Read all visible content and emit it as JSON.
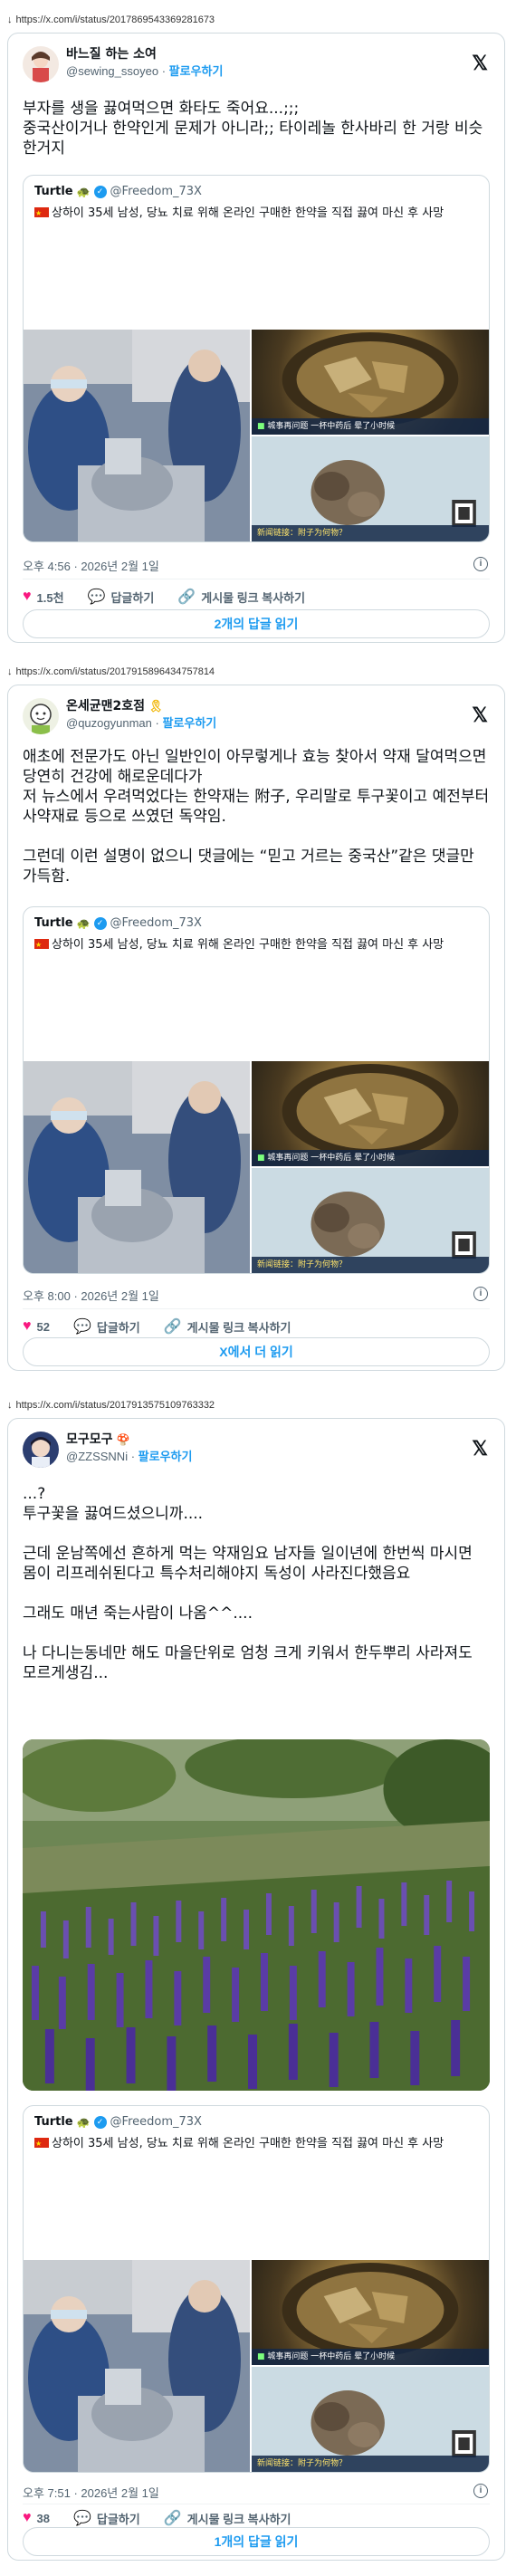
{
  "posts": [
    {
      "url": "https://x.com/i/status/2017869543369281673",
      "display_name": "바느질 하는 소여",
      "handle": "@sewing_ssoyeo",
      "follow_label": "팔로우하기",
      "body": "부자를 생을 끓여먹으면 화타도 죽어요...;;;\n중국산이거나 한약인게 문제가 아니라;; 타이레놀 한사바리 한 거랑 비슷한거지",
      "quote": {
        "name": "Turtle",
        "handle": "@Freedom_73X",
        "text": "상하이 35세 남성, 당뇨 치료 위해 온라인 구매한 한약을 직접 끓여 마신 후 사망",
        "tv_caption": "城事再问题 一杯中药后 晕了小时候",
        "tv_caption2": "新闻链接：附子为何物？"
      },
      "time": "오후 4:56 · 2026년 2월 1일",
      "likes": "1.5천",
      "reply_label": "답글하기",
      "copy_label": "게시물 링크 복사하기",
      "read_label": "2개의 답글 읽기"
    },
    {
      "url": "https://x.com/i/status/2017915896434757814",
      "display_name": "온세균맨2호점",
      "handle": "@quzogyunman",
      "follow_label": "팔로우하기",
      "body": "애초에 전문가도 아닌 일반인이 아무렇게나 효능 찾아서 약재 달여먹으면 당연히 건강에 해로운데다가\n저 뉴스에서 우려먹었다는 한약재는 附子, 우리말로 투구꽃이고 예전부터 사약재료 등으로 쓰였던 독약임.\n\n그런데 이런 설명이 없으니 댓글에는 “믿고 거르는 중국산”같은 댓글만 가득함.",
      "quote": {
        "name": "Turtle",
        "handle": "@Freedom_73X",
        "text": "상하이 35세 남성, 당뇨 치료 위해 온라인 구매한 한약을 직접 끓여 마신 후 사망",
        "tv_caption": "城事再问题 一杯中药后 晕了小时候",
        "tv_caption2": "新闻链接：附子为何物？"
      },
      "time": "오후 8:00 · 2026년 2월 1일",
      "likes": "52",
      "reply_label": "답글하기",
      "copy_label": "게시물 링크 복사하기",
      "read_label": "X에서 더 읽기"
    },
    {
      "url": "https://x.com/i/status/2017913575109763332",
      "display_name": "모구모구",
      "handle": "@ZZSSNNi",
      "follow_label": "팔로우하기",
      "body": "...?\n투구꽃을 끓여드셨으니까....\n\n근데 운남쪽에선 흔하게 먹는 약재임요 남자들 일이년에 한번씩 마시면 몸이 리프레쉬된다고 특수처리해야지 독성이 사라진다했음요\n\n그래도 매년 죽는사람이 나옴^^....\n\n나 다니는동네만 해도 마을단위로 엄청 크게 키워서 한두뿌리 사라져도 모르게생김...",
      "quote": {
        "name": "Turtle",
        "handle": "@Freedom_73X",
        "text": "상하이 35세 남성, 당뇨 치료 위해 온라인 구매한 한약을 직접 끓여 마신 후 사망",
        "tv_caption": "城事再问题 一杯中药后 晕了小时候",
        "tv_caption2": "新闻链接：附子为何物？"
      },
      "time": "오후 7:51 · 2026년 2월 1일",
      "likes": "38",
      "reply_label": "답글하기",
      "copy_label": "게시물 링크 복사하기",
      "read_label": "1개의 답글 읽기"
    }
  ],
  "icons": {
    "x_logo": "𝕏",
    "heart": "♥",
    "reply": "💬",
    "link": "🔗",
    "info": "i",
    "verified": "✓"
  },
  "colors": {
    "accent": "#1d9bf0",
    "like": "#f91880",
    "text": "#0f1419",
    "secondary": "#536471",
    "border": "#cfd9de"
  }
}
